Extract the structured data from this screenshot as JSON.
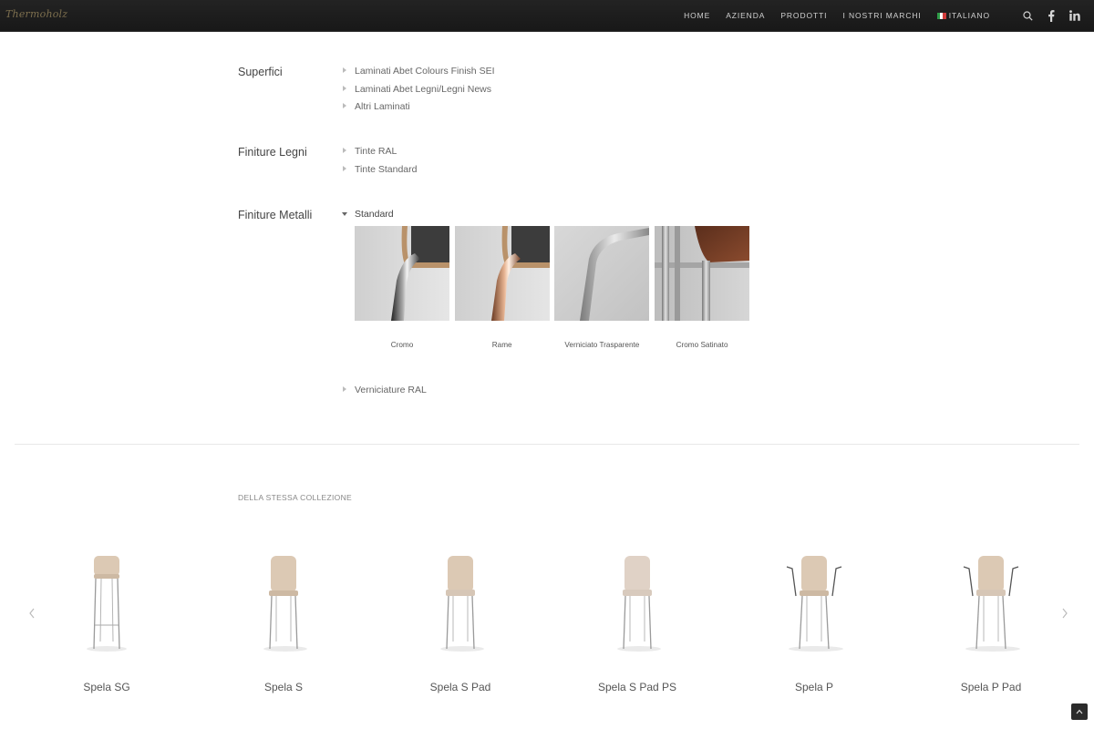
{
  "header": {
    "logo_text": "Thermoholz",
    "nav": [
      "HOME",
      "AZIENDA",
      "PRODOTTI",
      "I NOSTRI MARCHI",
      "ITALIANO"
    ],
    "icons": [
      "search-icon",
      "facebook-icon",
      "linkedin-icon"
    ]
  },
  "finishes": [
    {
      "title": "Superfici",
      "items": [
        "Laminati Abet Colours Finish SEI",
        "Laminati Abet Legni/Legni News",
        "Altri Laminati"
      ]
    },
    {
      "title": "Finiture Legni",
      "items": [
        "Tinte RAL",
        "Tinte Standard"
      ]
    },
    {
      "title": "Finiture Metalli",
      "items": [
        "Standard",
        "Verniciature RAL"
      ]
    }
  ],
  "metal_swatches": [
    "Cromo",
    "Rame",
    "Verniciato Trasparente",
    "Cromo Satinato"
  ],
  "collection": {
    "title": "DELLA STESSA COLLEZIONE",
    "products": [
      "Spela SG",
      "Spela S",
      "Spela S Pad",
      "Spela S Pad PS",
      "Spela P",
      "Spela P Pad"
    ]
  },
  "colors": {
    "nav_bg": "#1c1c1c",
    "logo": "#7d6f4e",
    "wood": "#d9c7b3"
  }
}
